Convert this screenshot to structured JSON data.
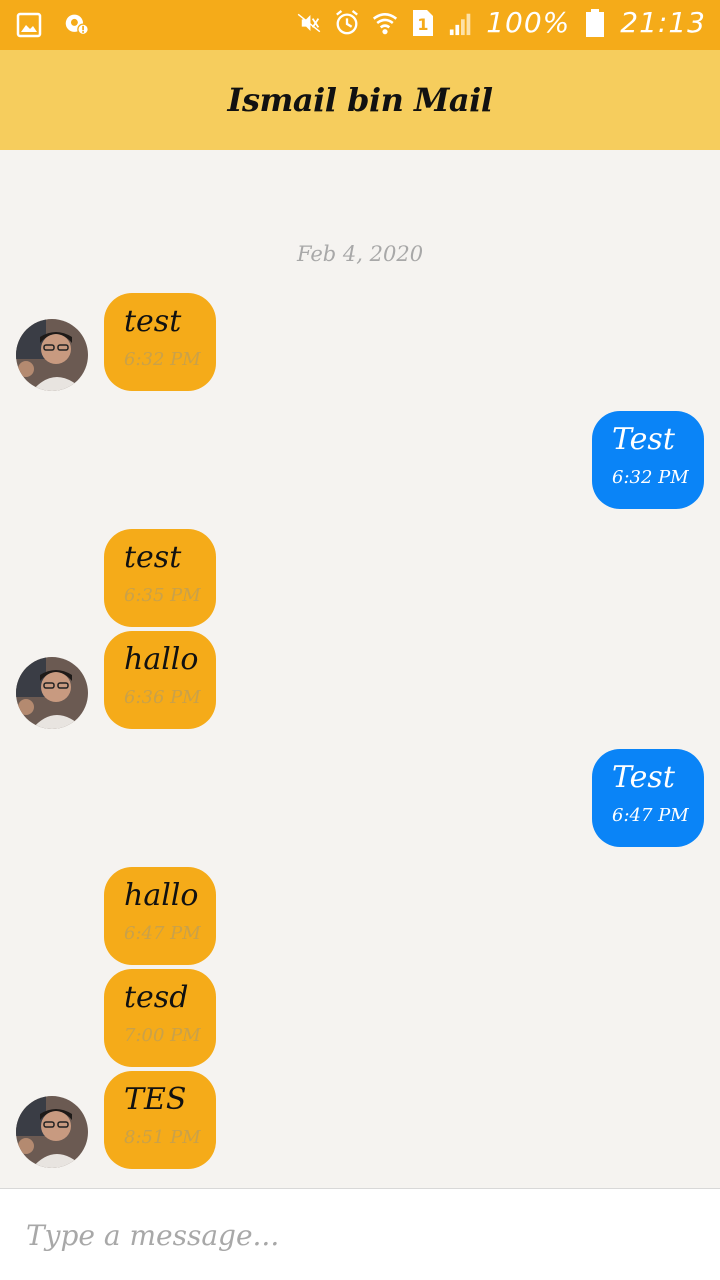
{
  "status_bar": {
    "battery": "100%",
    "time": "21:13",
    "sim": "1"
  },
  "header": {
    "title": "Ismail bin Mail"
  },
  "chat": {
    "date": "Feb 4, 2020",
    "messages": [
      {
        "dir": "in",
        "text": "test",
        "time": "6:32 PM"
      },
      {
        "dir": "out",
        "text": "Test",
        "time": "6:32 PM"
      },
      {
        "dir": "in",
        "text": "test",
        "time": "6:35 PM"
      },
      {
        "dir": "in",
        "text": "hallo",
        "time": "6:36 PM"
      },
      {
        "dir": "out",
        "text": "Test",
        "time": "6:47 PM"
      },
      {
        "dir": "in",
        "text": "hallo",
        "time": "6:47 PM"
      },
      {
        "dir": "in",
        "text": "tesd",
        "time": "7:00 PM"
      },
      {
        "dir": "in",
        "text": "TES",
        "time": "8:51 PM"
      }
    ]
  },
  "composer": {
    "placeholder": "Type a message..."
  },
  "colors": {
    "status_bar": "#f5ab19",
    "app_bar": "#f6cd5d",
    "incoming_bubble": "#f5ab19",
    "outgoing_bubble": "#0a84f7",
    "background": "#f5f3f0"
  }
}
